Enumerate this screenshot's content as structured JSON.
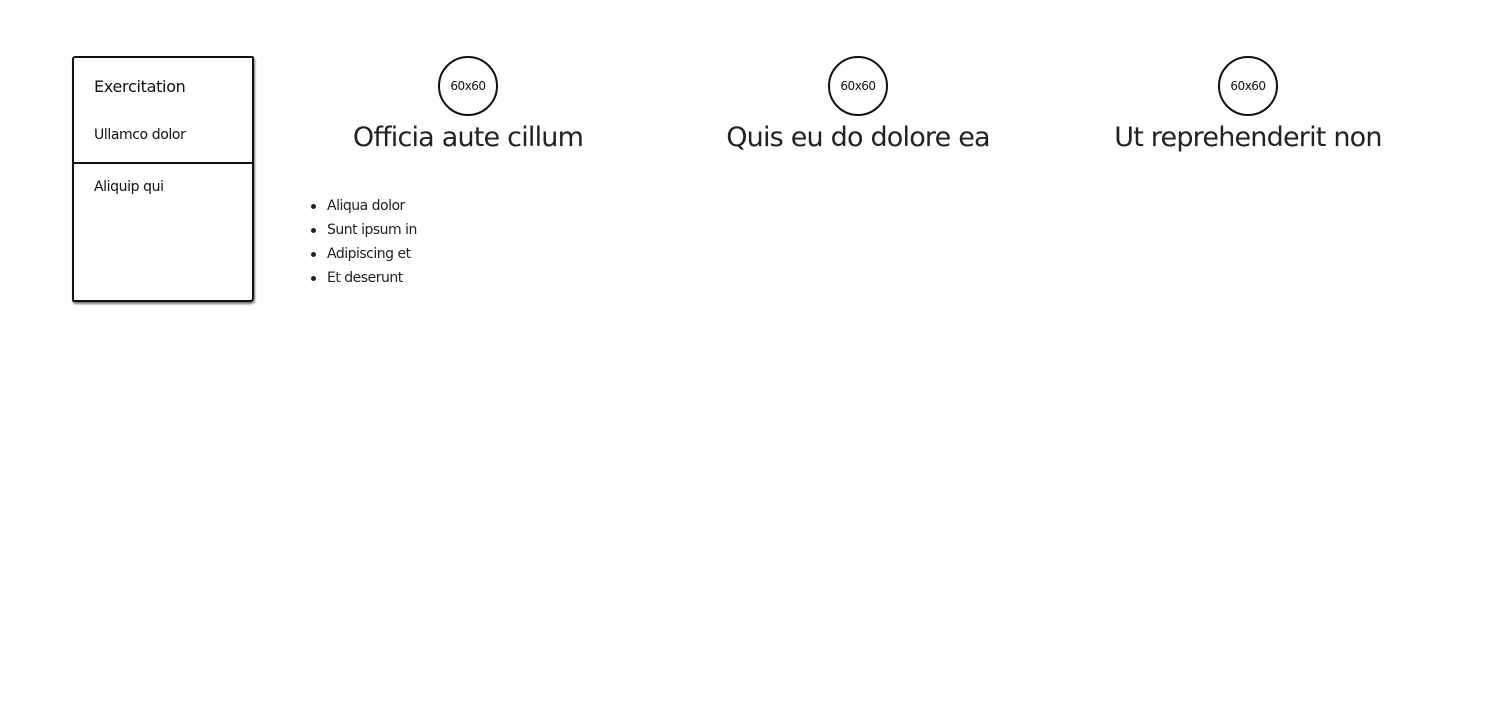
{
  "sidebar": {
    "title": "Exercitation",
    "subtitle": "Ullamco dolor",
    "item": "Aliquip qui"
  },
  "cards": [
    {
      "avatar_text": "60x60",
      "title": "Officia aute cillum"
    },
    {
      "avatar_text": "60x60",
      "title": "Quis eu do dolore ea"
    },
    {
      "avatar_text": "60x60",
      "title": "Ut reprehenderit non"
    }
  ],
  "list": {
    "items": [
      "Aliqua dolor",
      "Sunt ipsum in",
      "Adipiscing et",
      "Et deserunt"
    ]
  }
}
